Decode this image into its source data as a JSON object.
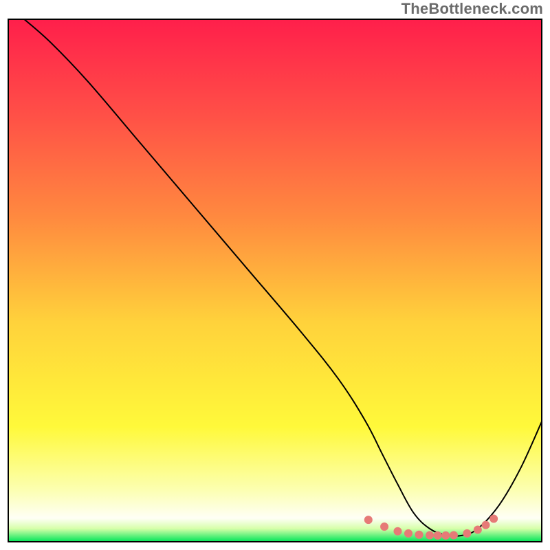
{
  "watermark": "TheBottleneck.com",
  "chart_data": {
    "type": "line",
    "title": "",
    "xlabel": "",
    "ylabel": "",
    "xlim": [
      0,
      100
    ],
    "ylim": [
      0,
      100
    ],
    "grid": false,
    "legend": false,
    "background_gradient": {
      "stops": [
        {
          "offset": 0.0,
          "color": "#ff1f4b"
        },
        {
          "offset": 0.18,
          "color": "#ff4f47"
        },
        {
          "offset": 0.38,
          "color": "#ff8a3f"
        },
        {
          "offset": 0.58,
          "color": "#ffd23b"
        },
        {
          "offset": 0.78,
          "color": "#fff93a"
        },
        {
          "offset": 0.9,
          "color": "#fcffb0"
        },
        {
          "offset": 0.955,
          "color": "#fefff6"
        },
        {
          "offset": 0.975,
          "color": "#d6ffa9"
        },
        {
          "offset": 1.0,
          "color": "#00e558"
        }
      ]
    },
    "series": [
      {
        "name": "curve",
        "type": "line",
        "color": "#000000",
        "width": 2,
        "x": [
          3,
          8,
          15,
          25,
          35,
          45,
          55,
          62,
          67,
          70,
          73,
          76,
          79,
          82,
          85,
          88,
          92,
          96,
          100
        ],
        "y": [
          100,
          95.5,
          88,
          76,
          64,
          52,
          40,
          31,
          23,
          17,
          11,
          5.5,
          2.5,
          1.3,
          1.2,
          2.5,
          7,
          14,
          23
        ]
      },
      {
        "name": "markers",
        "type": "scatter",
        "color": "#e67a77",
        "radius": 6,
        "x": [
          67.5,
          70.5,
          73,
          75,
          77,
          79,
          80.5,
          82,
          83.5,
          86,
          88,
          89.5,
          91
        ],
        "y": [
          4.2,
          2.9,
          2.0,
          1.6,
          1.35,
          1.25,
          1.2,
          1.2,
          1.25,
          1.6,
          2.3,
          3.2,
          4.4
        ]
      }
    ]
  }
}
